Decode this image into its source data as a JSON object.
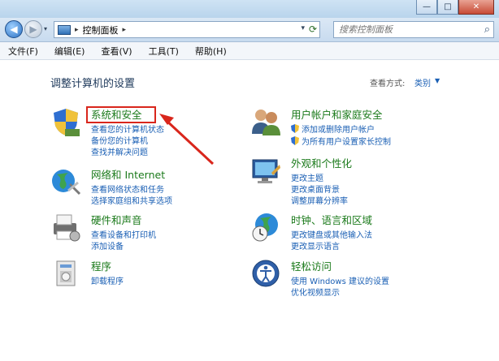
{
  "window": {
    "minimize_glyph": "—",
    "maximize_glyph": "□",
    "close_glyph": "✕"
  },
  "address": {
    "back_glyph": "◀",
    "forward_glyph": "▶",
    "history_dropdown_glyph": "▾",
    "separator_glyph": "▸",
    "path": "控制面板",
    "dropdown_glyph": "▾",
    "refresh_glyph": "⟳"
  },
  "search": {
    "placeholder": "搜索控制面板",
    "icon_glyph": "⌕"
  },
  "menu": [
    "文件(F)",
    "编辑(E)",
    "查看(V)",
    "工具(T)",
    "帮助(H)"
  ],
  "page": {
    "title": "调整计算机的设置",
    "view_by_label": "查看方式:",
    "view_by_value": "类别",
    "view_by_arrow": "▼"
  },
  "categories": {
    "system_security": {
      "title": "系统和安全",
      "links": [
        "查看您的计算机状态",
        "备份您的计算机",
        "查找并解决问题"
      ]
    },
    "network": {
      "title": "网络和 Internet",
      "links": [
        "查看网络状态和任务",
        "选择家庭组和共享选项"
      ]
    },
    "hardware": {
      "title": "硬件和声音",
      "links": [
        "查看设备和打印机",
        "添加设备"
      ]
    },
    "programs": {
      "title": "程序",
      "links": [
        "卸载程序"
      ]
    },
    "user_accounts": {
      "title": "用户帐户和家庭安全",
      "links": [
        "添加或删除用户帐户",
        "为所有用户设置家长控制"
      ]
    },
    "appearance": {
      "title": "外观和个性化",
      "links": [
        "更改主题",
        "更改桌面背景",
        "调整屏幕分辨率"
      ]
    },
    "clock": {
      "title": "时钟、语言和区域",
      "links": [
        "更改键盘或其他输入法",
        "更改显示语言"
      ]
    },
    "ease": {
      "title": "轻松访问",
      "links": [
        "使用 Windows 建议的设置",
        "优化视频显示"
      ]
    }
  },
  "colors": {
    "category_title": "#1b7a1b",
    "link": "#1a5fb4",
    "annotation": "#d9261c"
  }
}
